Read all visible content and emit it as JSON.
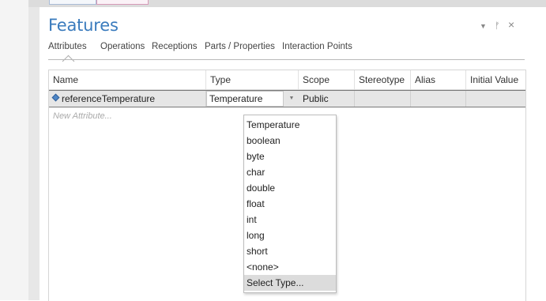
{
  "panel": {
    "title": "Features",
    "controls": {
      "menu_glyph": "▼",
      "pin_glyph": "ᚠ",
      "close_glyph": "×"
    }
  },
  "tabs": [
    "Attributes",
    "Operations",
    "Receptions",
    "Parts / Properties",
    "Interaction Points"
  ],
  "grid": {
    "columns": [
      "Name",
      "Type",
      "Scope",
      "Stereotype",
      "Alias",
      "Initial Value"
    ],
    "rows": [
      {
        "name": "referenceTemperature",
        "type": "Temperature",
        "scope": "Public",
        "stereotype": "",
        "alias": "",
        "initial_value": ""
      }
    ],
    "new_row_placeholder": "New Attribute..."
  },
  "type_dropdown": {
    "arrow_glyph": "▼",
    "options": [
      "Temperature",
      "boolean",
      "byte",
      "char",
      "double",
      "float",
      "int",
      "long",
      "short",
      "<none>",
      "Select Type..."
    ],
    "highlighted": "Select Type..."
  },
  "colors": {
    "title": "#3a7bbd",
    "row_selected": "#e6e6e6",
    "highlight": "#dcdcdc"
  },
  "icons": {
    "attribute": "attribute-diamond-icon"
  }
}
